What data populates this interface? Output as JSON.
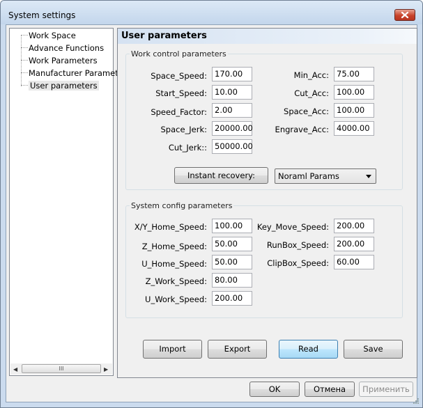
{
  "window": {
    "title": "System settings"
  },
  "tree": {
    "items": [
      {
        "label": "Work Space"
      },
      {
        "label": "Advance Functions"
      },
      {
        "label": "Work Parameters"
      },
      {
        "label": "Manufacturer Paramet"
      },
      {
        "label": "User parameters"
      }
    ],
    "scroll_thumb_glyph": "III"
  },
  "panel": {
    "title": "User parameters",
    "work_control": {
      "label": "Work control parameters",
      "left": [
        {
          "label": "Space_Speed:",
          "value": "170.00"
        },
        {
          "label": "Start_Speed:",
          "value": "10.00"
        },
        {
          "label": "Speed_Factor:",
          "value": "2.00"
        },
        {
          "label": "Space_Jerk:",
          "value": "20000.00"
        },
        {
          "label": "Cut_Jerk::",
          "value": "50000.00"
        }
      ],
      "right": [
        {
          "label": "Min_Acc:",
          "value": "75.00"
        },
        {
          "label": "Cut_Acc:",
          "value": "100.00"
        },
        {
          "label": "Space_Acc:",
          "value": "100.00"
        },
        {
          "label": "Engrave_Acc:",
          "value": "4000.00"
        }
      ],
      "recovery_button": "Instant recovery:",
      "params_select": "Noraml Params"
    },
    "system_config": {
      "label": "System config parameters",
      "left": [
        {
          "label": "X/Y_Home_Speed:",
          "value": "100.00"
        },
        {
          "label": "Z_Home_Speed:",
          "value": "50.00"
        },
        {
          "label": "U_Home_Speed:",
          "value": "50.00"
        },
        {
          "label": "Z_Work_Speed:",
          "value": "80.00"
        },
        {
          "label": "U_Work_Speed:",
          "value": "200.00"
        }
      ],
      "right": [
        {
          "label": "Key_Move_Speed:",
          "value": "200.00"
        },
        {
          "label": "RunBox_Speed:",
          "value": "200.00"
        },
        {
          "label": "ClipBox_Speed:",
          "value": "60.00"
        }
      ]
    },
    "actions": {
      "import": "Import",
      "export": "Export",
      "read": "Read",
      "save": "Save"
    }
  },
  "footer": {
    "ok": "OK",
    "cancel": "Отмена",
    "apply": "Применить"
  }
}
